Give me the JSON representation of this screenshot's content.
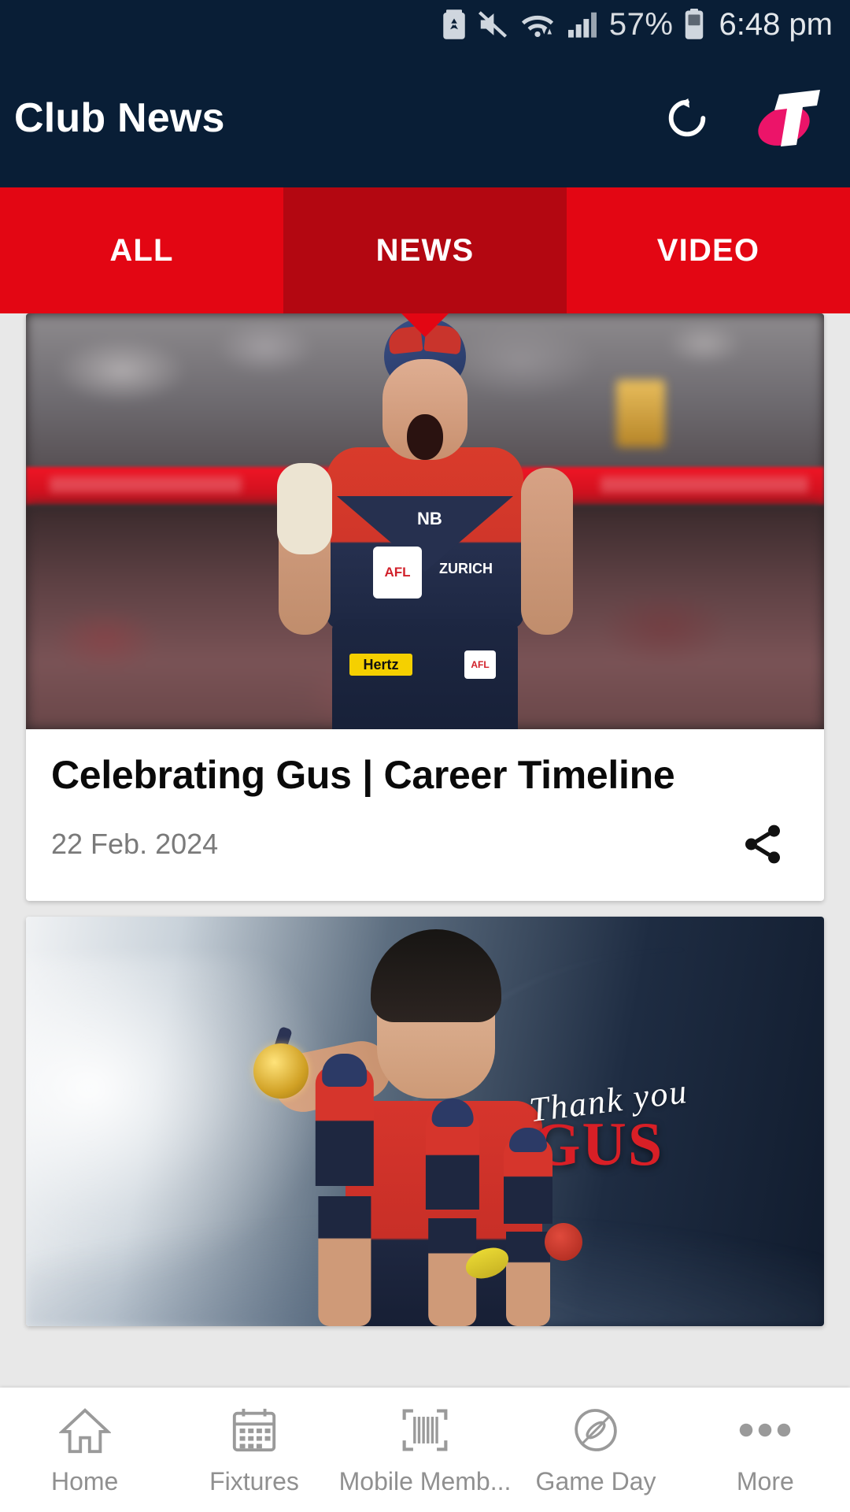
{
  "status_bar": {
    "icons": [
      "battery-saver-icon",
      "mute-icon",
      "wifi-icon",
      "signal-icon"
    ],
    "battery_percent": "57%",
    "battery_icon": "battery-icon",
    "time": "6:48 pm"
  },
  "app_bar": {
    "title": "Club News",
    "refresh_icon": "refresh-icon",
    "sponsor_logo": "telstra-logo",
    "background_color": "#091e36"
  },
  "tabs": {
    "accent_color": "#e30613",
    "active_color": "#b30711",
    "items": [
      {
        "label": "ALL",
        "active": false
      },
      {
        "label": "NEWS",
        "active": true
      },
      {
        "label": "VIDEO",
        "active": false
      }
    ]
  },
  "feed": {
    "articles": [
      {
        "title": "Celebrating Gus | Career Timeline",
        "date": "22 Feb. 2024",
        "share_icon": "share-icon",
        "image_alt": "AFL player in Melbourne Demons red and navy guernsey celebrating with clenched fists",
        "image_badges": {
          "afl": "AFL",
          "sponsor": "ZURICH",
          "brand": "NB",
          "shorts_sponsor": "Hertz",
          "shorts_badge": "AFL"
        }
      },
      {
        "title": "",
        "date": "",
        "image_alt": "Thank you Gus tribute graphic with player holding premiership medal",
        "overlay_line_1": "Thank you",
        "overlay_line_2": "GUS"
      }
    ]
  },
  "bottom_nav": {
    "items": [
      {
        "label": "Home",
        "icon": "home-icon",
        "active": false
      },
      {
        "label": "Fixtures",
        "icon": "calendar-icon",
        "active": false
      },
      {
        "label": "Mobile Memb...",
        "icon": "barcode-icon",
        "active": false
      },
      {
        "label": "Game Day",
        "icon": "football-icon",
        "active": false
      },
      {
        "label": "More",
        "icon": "more-dots-icon",
        "active": false
      }
    ]
  }
}
